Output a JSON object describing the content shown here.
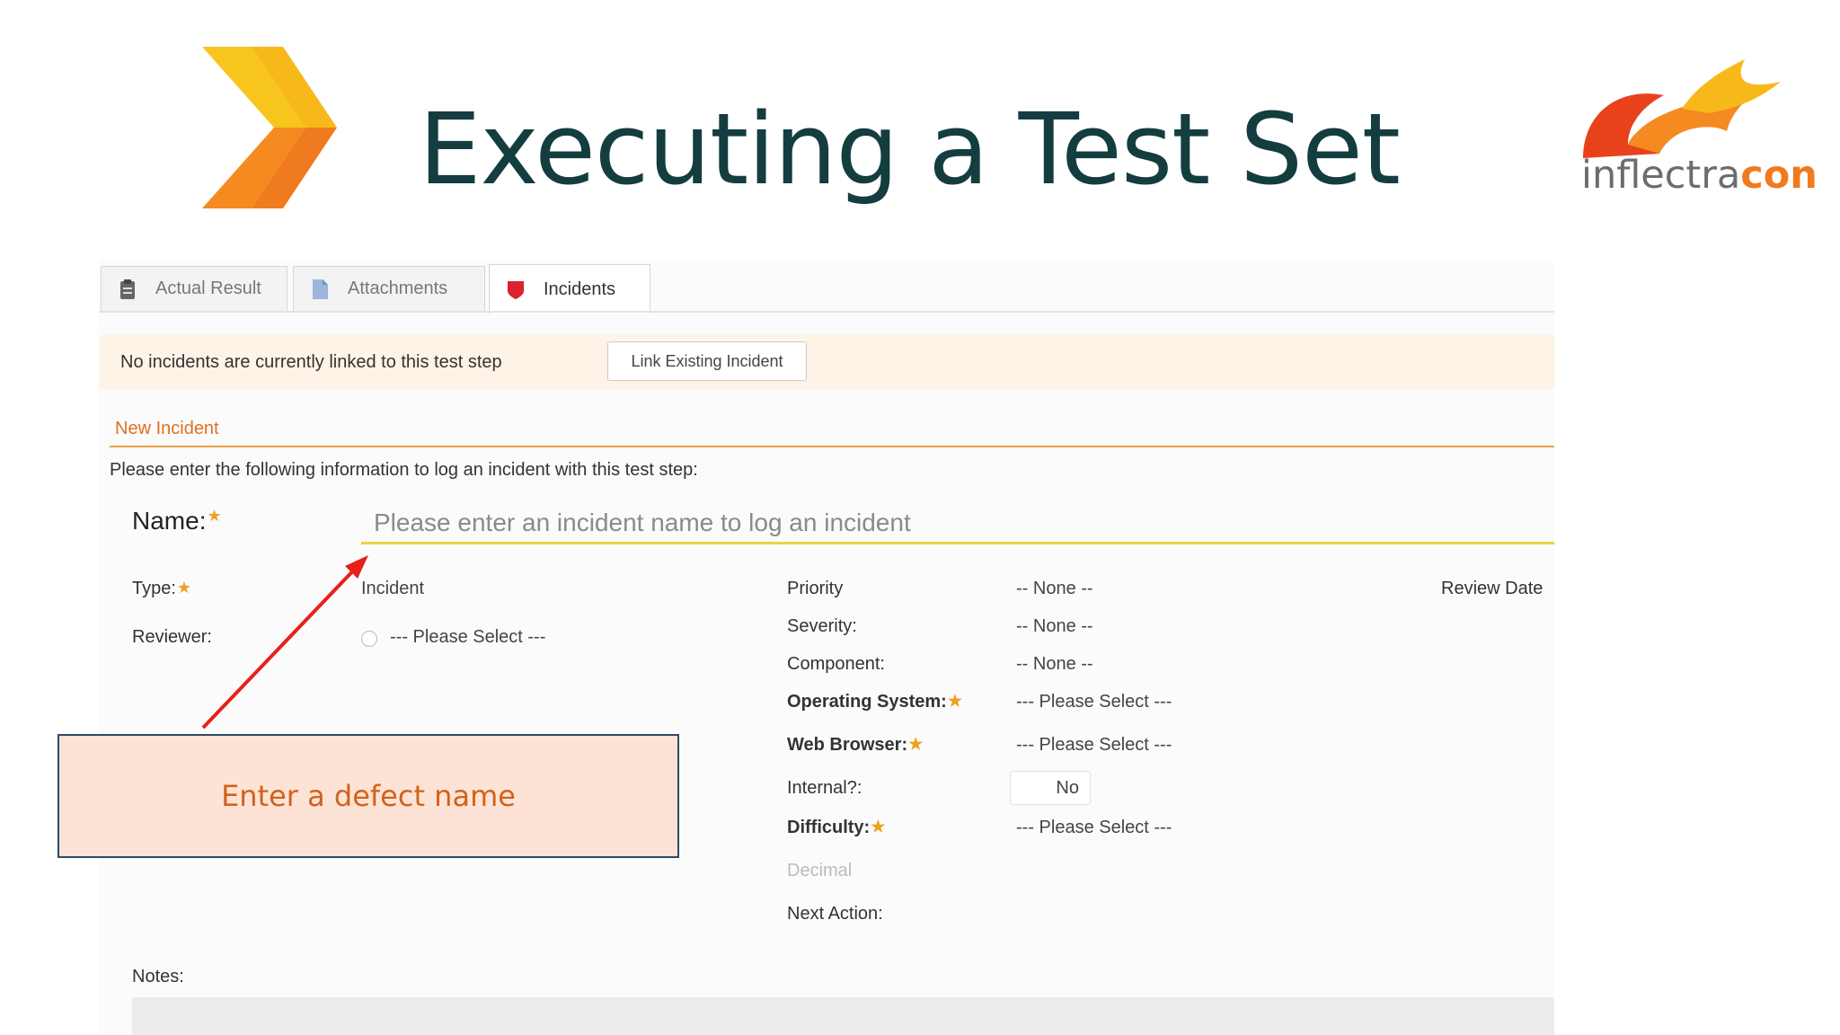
{
  "slide": {
    "title": "Executing a Test Set",
    "logo": {
      "part1": "inflectra",
      "part2": "con"
    }
  },
  "tabs": [
    {
      "label": "Actual Result",
      "icon": "clipboard-icon"
    },
    {
      "label": "Attachments",
      "icon": "document-icon"
    },
    {
      "label": "Incidents",
      "icon": "shield-icon",
      "active": true
    }
  ],
  "banner": {
    "text": "No incidents are currently linked to this test step",
    "button": "Link Existing Incident"
  },
  "new_incident": {
    "section_title": "New Incident",
    "instructions": "Please enter the following information to log an incident with this test step:",
    "name_label": "Name:",
    "name_placeholder": "Please enter an incident name to log an incident",
    "fields_left": {
      "type_label": "Type:",
      "type_value": "Incident",
      "reviewer_label": "Reviewer:",
      "reviewer_value": "--- Please Select ---"
    },
    "fields_right": {
      "priority_label": "Priority",
      "priority_value": "-- None --",
      "severity_label": "Severity:",
      "severity_value": "-- None --",
      "component_label": "Component:",
      "component_value": "-- None --",
      "os_label": "Operating System:",
      "os_value": "--- Please Select ---",
      "browser_label": "Web Browser:",
      "browser_value": "--- Please Select ---",
      "internal_label": "Internal?:",
      "internal_value": "No",
      "difficulty_label": "Difficulty:",
      "difficulty_value": "--- Please Select ---",
      "decimal_label": "Decimal",
      "next_action_label": "Next Action:"
    },
    "review_date_label": "Review Date",
    "notes_label": "Notes:"
  },
  "callout": {
    "text": "Enter a defect name"
  },
  "colors": {
    "title": "#143d40",
    "accent_orange": "#e07020",
    "banner_bg": "#fdf4e7",
    "callout_bg": "#fde3d5",
    "callout_border": "#2d4a6b",
    "arrow": "#e8201c",
    "required_star": "#f0a020"
  }
}
